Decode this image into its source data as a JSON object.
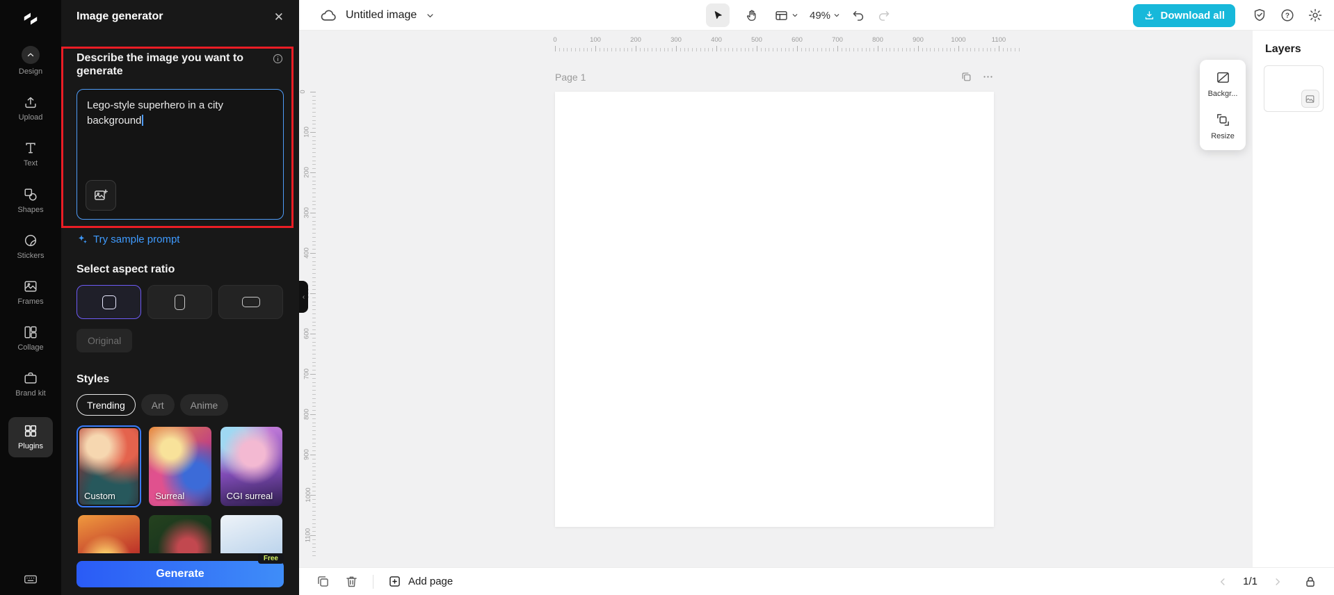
{
  "colors": {
    "accent_cyan": "#17b8da",
    "accent_blue_start": "#2a5bf6",
    "accent_blue_end": "#3f8df8",
    "link_blue": "#3f9bff",
    "highlight_red": "#ea1d25",
    "selected_purple": "#6e5bf6",
    "selected_card_blue": "#3a7bfb"
  },
  "sidebar": {
    "items": [
      {
        "id": "design",
        "label": "Design"
      },
      {
        "id": "upload",
        "label": "Upload"
      },
      {
        "id": "text",
        "label": "Text"
      },
      {
        "id": "shapes",
        "label": "Shapes"
      },
      {
        "id": "stickers",
        "label": "Stickers"
      },
      {
        "id": "frames",
        "label": "Frames"
      },
      {
        "id": "collage",
        "label": "Collage"
      },
      {
        "id": "brand-kit",
        "label": "Brand kit"
      },
      {
        "id": "plugins",
        "label": "Plugins",
        "active": true
      }
    ]
  },
  "panel": {
    "title": "Image generator",
    "prompt": {
      "label": "Describe the image you want to generate",
      "value": "Lego-style superhero in a city background",
      "sample_prompt_label": "Try sample prompt"
    },
    "aspect_ratio": {
      "label": "Select aspect ratio",
      "options": [
        {
          "id": "square",
          "selected": true
        },
        {
          "id": "portrait",
          "selected": false
        },
        {
          "id": "landscape",
          "selected": false
        }
      ],
      "original_label": "Original"
    },
    "styles": {
      "label": "Styles",
      "tabs": [
        {
          "label": "Trending",
          "active": true
        },
        {
          "label": "Art",
          "active": false
        },
        {
          "label": "Anime",
          "active": false
        }
      ],
      "items": [
        {
          "label": "Custom",
          "selected": true
        },
        {
          "label": "Surreal",
          "selected": false
        },
        {
          "label": "CGI surreal",
          "selected": false
        }
      ],
      "partial_thumbnails_visible": 3
    },
    "generate_label": "Generate",
    "free_badge": "Free"
  },
  "toolbar": {
    "doc_title": "Untitled image",
    "zoom": "49%",
    "download_label": "Download all"
  },
  "canvas": {
    "page_label": "Page 1",
    "ruler_labels": [
      "0",
      "100",
      "200",
      "300",
      "400",
      "500",
      "600",
      "700",
      "800",
      "900",
      "1000",
      "1100"
    ]
  },
  "floating_panel": {
    "background_label": "Backgr...",
    "resize_label": "Resize"
  },
  "layers": {
    "title": "Layers"
  },
  "bottom_bar": {
    "add_page_label": "Add page",
    "page_indicator": "1/1"
  }
}
